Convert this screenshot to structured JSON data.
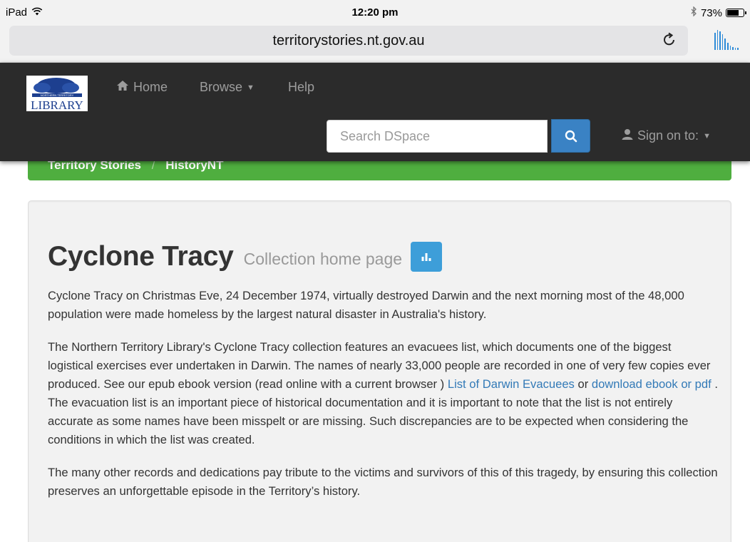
{
  "status_bar": {
    "device": "iPad",
    "time": "12:20 pm",
    "battery": "73%",
    "battery_level": 0.73
  },
  "browser": {
    "url": "territorystories.nt.gov.au",
    "reload_icon": "reload-icon"
  },
  "navbar": {
    "logo_text": "LIBRARY",
    "logo_tag": "NORTHERN TERRITORY",
    "home_label": "Home",
    "browse_label": "Browse",
    "help_label": "Help",
    "search_placeholder": "Search DSpace",
    "signon_label": "Sign on to:"
  },
  "breadcrumb": {
    "items": [
      "Territory Stories",
      "HistoryNT"
    ],
    "separator": "/"
  },
  "collection": {
    "title": "Cyclone Tracy",
    "subtitle": "Collection home page",
    "para1": "Cyclone Tracy on Christmas Eve, 24 December 1974, virtually destroyed Darwin and the next morning most of the 48,000 population were made homeless by the largest natural disaster in Australia's history.",
    "para2_intro": "The Northern Territory Library's Cyclone Tracy collection features an evacuees list, which documents one of the biggest logistical exercises ever undertaken in Darwin. The names of nearly 33,000 people are recorded in one of very few copies ever produced. See our epub ebook version (read online with a current browser )",
    "link1": "List of Darwin Evacuees",
    "or_text": " or ",
    "link2": "download ebook or pdf",
    "para2_rest": " . The evacuation list is an important piece of historical documentation and it is important to note that the list is not entirely accurate as some names have been misspelt or are missing. Such discrepancies are to be expected when considering the conditions in which the list was created.",
    "para3": "The many other records and dedications pay tribute to the victims and survivors of this of this tragedy, by ensuring this collection preserves an unforgettable episode in the Territory’s history."
  },
  "colors": {
    "navbar_bg": "#2b2b2b",
    "breadcrumb_bg": "#4fae3f",
    "search_button": "#3a82c4",
    "stats_button": "#3d9ed9",
    "link": "#337ab7"
  }
}
